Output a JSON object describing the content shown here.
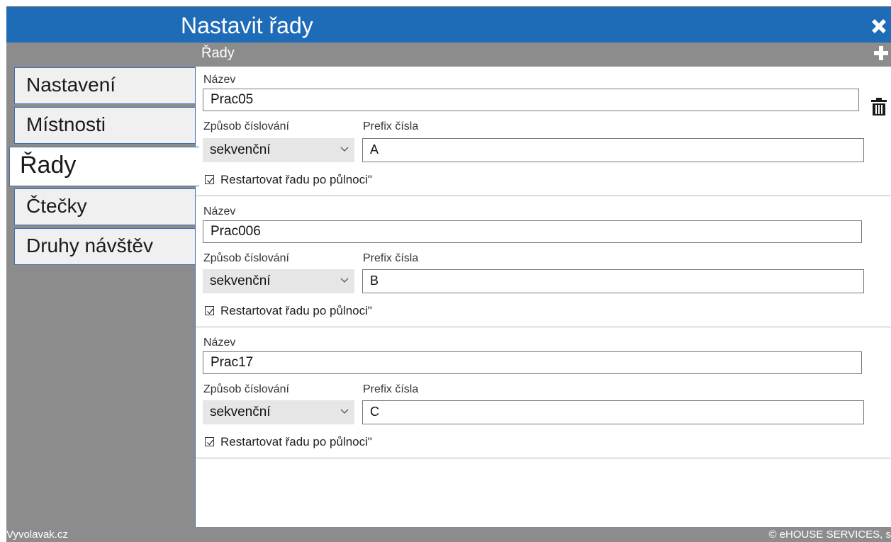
{
  "window": {
    "title": "Nastavit řady",
    "close_icon": "close-icon"
  },
  "sidebar": {
    "items": [
      {
        "label": "Nastavení",
        "active": false
      },
      {
        "label": "Místnosti",
        "active": false
      },
      {
        "label": "Řady",
        "active": true
      },
      {
        "label": "Čtečky",
        "active": false
      },
      {
        "label": "Druhy návštěv",
        "active": false
      }
    ]
  },
  "section": {
    "title": "Řady",
    "add_icon": "plus-icon"
  },
  "rows": [
    {
      "name_label": "Název",
      "name_value": "Prac05",
      "numbering_label": "Způsob číslování",
      "numbering_value": "sekvenční",
      "prefix_label": "Prefix čísla",
      "prefix_value": "A",
      "restart_label": "Restartovat řadu po půlnoci\"",
      "restart_checked": true,
      "delete_icon": "trash-icon"
    },
    {
      "name_label": "Název",
      "name_value": "Prac006",
      "numbering_label": "Způsob číslování",
      "numbering_value": "sekvenční",
      "prefix_label": "Prefix čísla",
      "prefix_value": "B",
      "restart_label": "Restartovat řadu po půlnoci\"",
      "restart_checked": true
    },
    {
      "name_label": "Název",
      "name_value": "Prac17",
      "numbering_label": "Způsob číslování",
      "numbering_value": "sekvenční",
      "prefix_label": "Prefix čísla",
      "prefix_value": "C",
      "restart_label": "Restartovat řadu po půlnoci\"",
      "restart_checked": true
    }
  ],
  "footer": {
    "left": "Vyvolavak.cz",
    "right": "© eHOUSE SERVICES, s"
  },
  "colors": {
    "titlebar": "#1e6bb8",
    "background": "#8c8c8c",
    "border_accent": "#3d6fae"
  }
}
